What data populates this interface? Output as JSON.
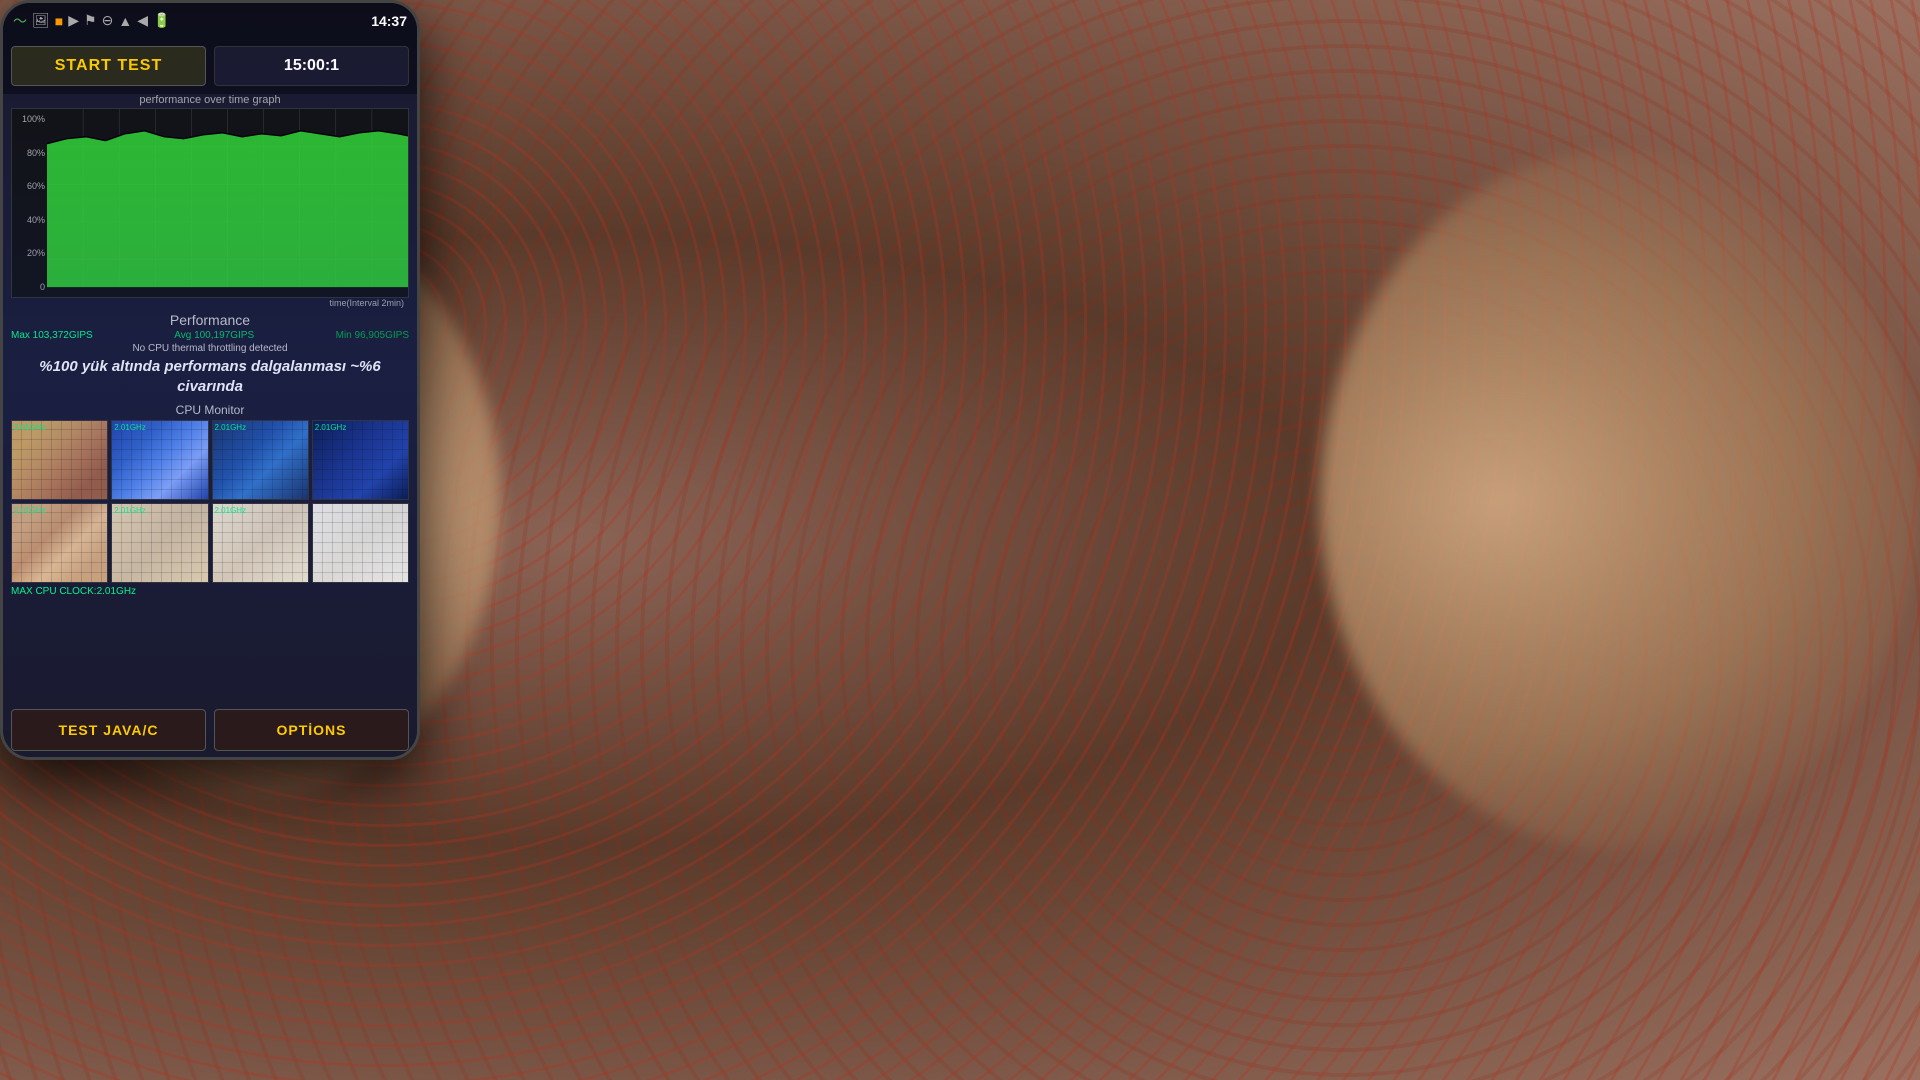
{
  "background": {
    "description": "Carpet background with red/brown pattern"
  },
  "statusBar": {
    "time": "14:37",
    "icons": [
      "~",
      "📷",
      "■",
      "▶",
      "⊕",
      "⊖",
      "▲",
      "◀",
      "🔋"
    ]
  },
  "topRow": {
    "startTestLabel": "START TEST",
    "timerValue": "15:00:1"
  },
  "graph": {
    "title": "performance over time graph",
    "yLabels": [
      "100%",
      "80%",
      "60%",
      "40%",
      "20%",
      "0"
    ],
    "timeLabel": "time(Interval 2min)"
  },
  "performance": {
    "title": "Performance",
    "maxLabel": "Max 103,372GIPS",
    "avgLabel": "Avg 100,197GIPS",
    "minLabel": "Min 96,905GIPS",
    "throttleStatus": "No CPU thermal throttling detected",
    "note": "%100 yük altında performans dalgalanması ~%6 civarında"
  },
  "cpuMonitor": {
    "title": "CPU Monitor",
    "cells": [
      {
        "freq": "2.01GHz",
        "row": 0,
        "col": 0
      },
      {
        "freq": "2.01GHz",
        "row": 0,
        "col": 1
      },
      {
        "freq": "2.01GHz",
        "row": 0,
        "col": 2
      },
      {
        "freq": "2.01GHz",
        "row": 0,
        "col": 3
      },
      {
        "freq": "2.01GHz",
        "row": 1,
        "col": 0
      },
      {
        "freq": "2.01GHz",
        "row": 1,
        "col": 1
      },
      {
        "freq": "2.01GHz",
        "row": 1,
        "col": 2
      },
      {
        "freq": "",
        "row": 1,
        "col": 3
      }
    ],
    "maxCpuClock": "MAX CPU CLOCK:2.01GHz"
  },
  "bottomButtons": {
    "testJavaC": "TEST JAVA/C",
    "options": "OPTİONS"
  }
}
